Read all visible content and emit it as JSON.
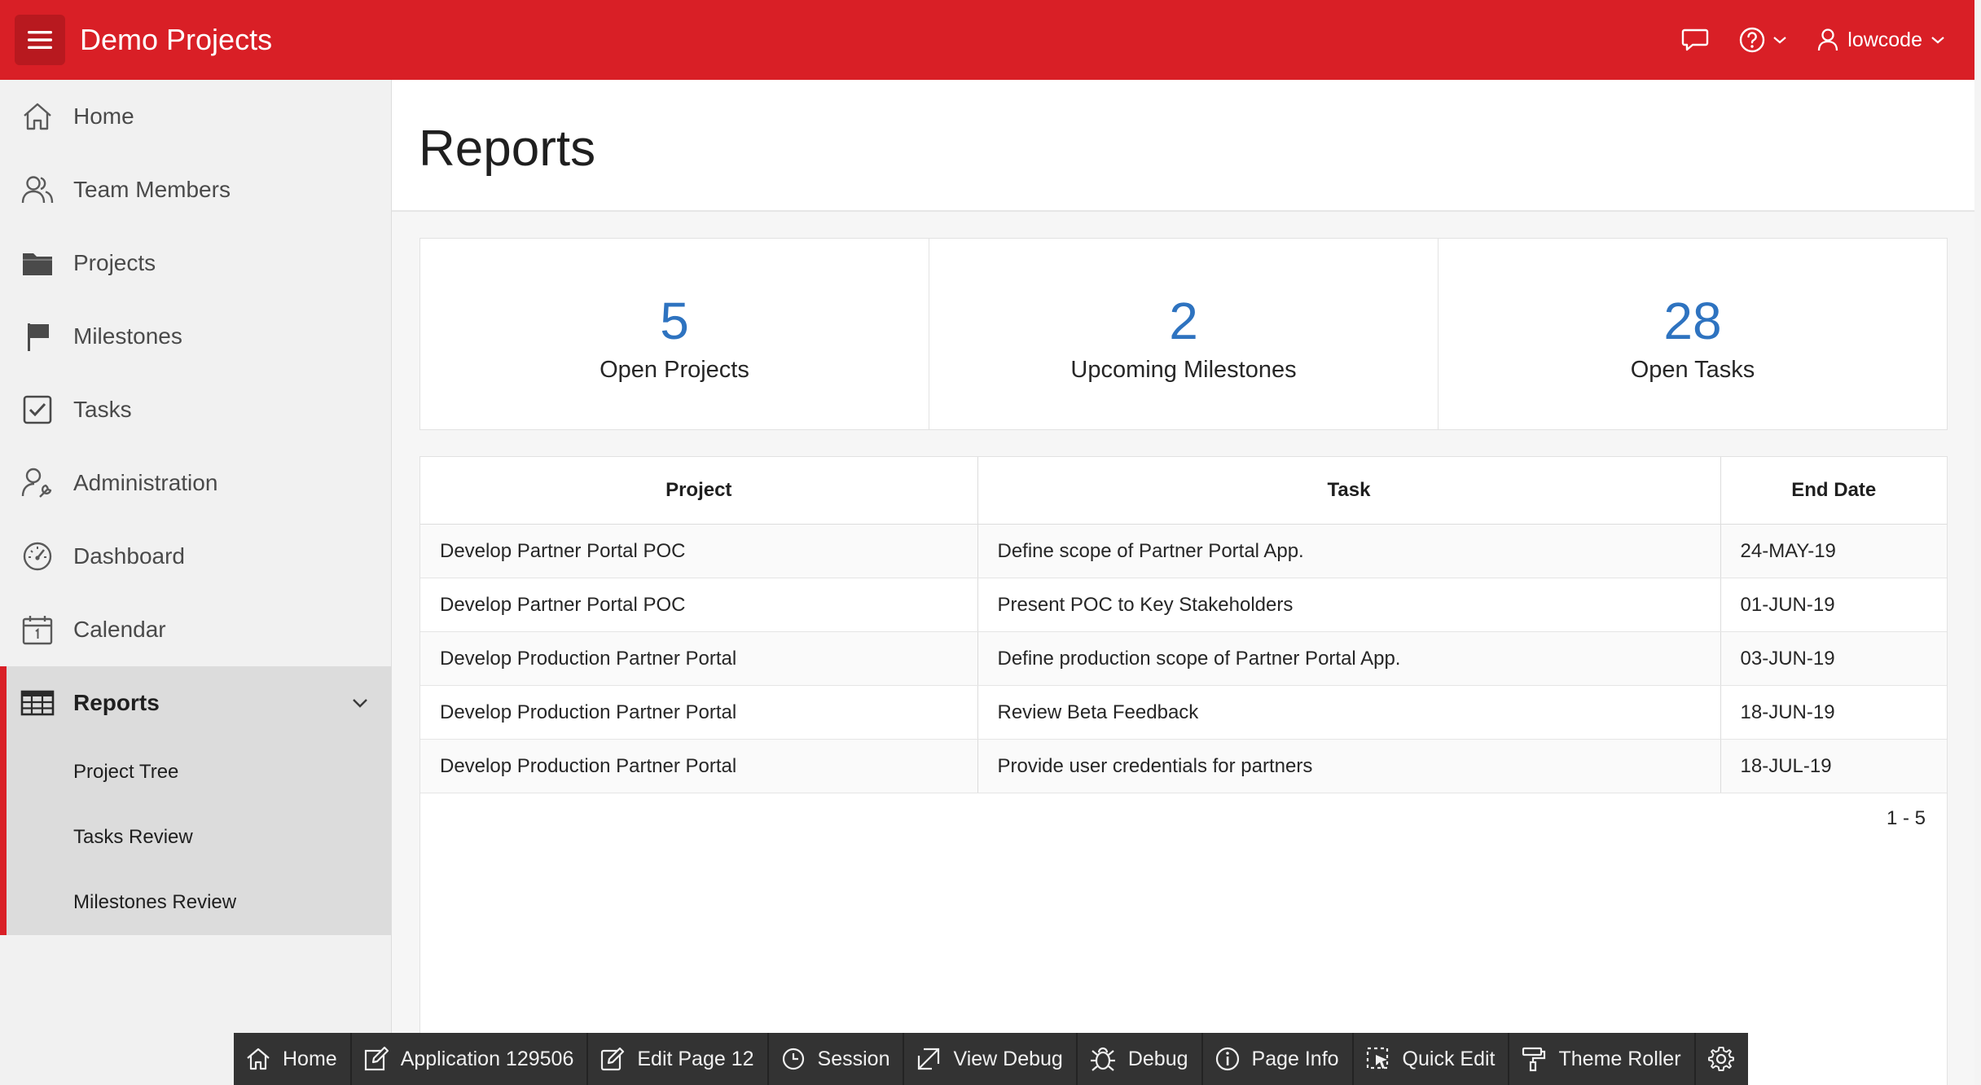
{
  "app": {
    "title": "Demo Projects"
  },
  "header": {
    "user": "lowcode"
  },
  "sidebar": {
    "items": [
      {
        "label": "Home",
        "icon": "home-icon"
      },
      {
        "label": "Team Members",
        "icon": "users-icon"
      },
      {
        "label": "Projects",
        "icon": "folder-icon"
      },
      {
        "label": "Milestones",
        "icon": "flag-icon"
      },
      {
        "label": "Tasks",
        "icon": "checkbox-icon"
      },
      {
        "label": "Administration",
        "icon": "user-wrench-icon"
      },
      {
        "label": "Dashboard",
        "icon": "gauge-icon"
      },
      {
        "label": "Calendar",
        "icon": "calendar-icon"
      },
      {
        "label": "Reports",
        "icon": "table-icon"
      }
    ],
    "active": "Reports",
    "sub_items": [
      "Project Tree",
      "Tasks Review",
      "Milestones Review"
    ]
  },
  "page": {
    "title": "Reports"
  },
  "badges": [
    {
      "value": "5",
      "label": "Open Projects"
    },
    {
      "value": "2",
      "label": "Upcoming Milestones"
    },
    {
      "value": "28",
      "label": "Open Tasks"
    }
  ],
  "report": {
    "columns": [
      "Project",
      "Task",
      "End Date"
    ],
    "rows": [
      [
        "Develop Partner Portal POC",
        "Define scope of Partner Portal App.",
        "24-MAY-19"
      ],
      [
        "Develop Partner Portal POC",
        "Present POC to Key Stakeholders",
        "01-JUN-19"
      ],
      [
        "Develop Production Partner Portal",
        "Define production scope of Partner Portal App.",
        "03-JUN-19"
      ],
      [
        "Develop Production Partner Portal",
        "Review Beta Feedback",
        "18-JUN-19"
      ],
      [
        "Develop Production Partner Portal",
        "Provide user credentials for partners",
        "18-JUL-19"
      ]
    ],
    "pagination": "1 - 5"
  },
  "devbar": {
    "items": [
      {
        "label": "Home",
        "icon": "home-icon"
      },
      {
        "label": "Application 129506",
        "icon": "edit-box-icon"
      },
      {
        "label": "Edit Page 12",
        "icon": "pencil-icon"
      },
      {
        "label": "Session",
        "icon": "clock-icon"
      },
      {
        "label": "View Debug",
        "icon": "open-arrow-icon"
      },
      {
        "label": "Debug",
        "icon": "bug-icon"
      },
      {
        "label": "Page Info",
        "icon": "info-icon"
      },
      {
        "label": "Quick Edit",
        "icon": "select-cursor-icon"
      },
      {
        "label": "Theme Roller",
        "icon": "paint-roller-icon"
      },
      {
        "label": "",
        "icon": "gear-icon"
      }
    ]
  },
  "colors": {
    "brand": "#d91f26",
    "badge_value": "#2e73c0",
    "devbar": "#333333"
  }
}
